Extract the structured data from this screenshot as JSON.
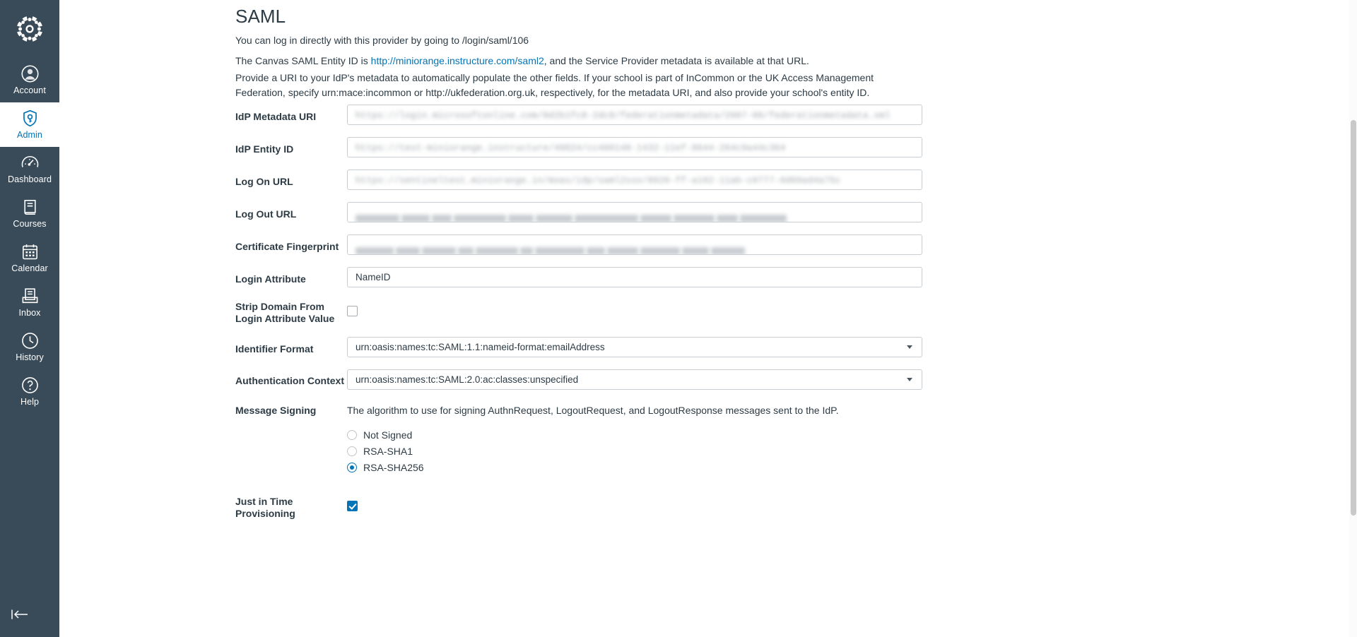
{
  "sidebar": {
    "logo_name": "canvas-logo",
    "items": [
      {
        "label": "Account",
        "icon": "user-circle-icon",
        "active": false
      },
      {
        "label": "Admin",
        "icon": "shield-key-icon",
        "active": true
      },
      {
        "label": "Dashboard",
        "icon": "speedometer-icon",
        "active": false
      },
      {
        "label": "Courses",
        "icon": "book-icon",
        "active": false
      },
      {
        "label": "Calendar",
        "icon": "calendar-icon",
        "active": false
      },
      {
        "label": "Inbox",
        "icon": "inbox-tray-icon",
        "active": false
      },
      {
        "label": "History",
        "icon": "clock-icon",
        "active": false
      },
      {
        "label": "Help",
        "icon": "question-circle-icon",
        "active": false
      }
    ],
    "collapse_icon": "collapse-left-arrow-icon",
    "accent_active_color": "#0374B5",
    "background_color": "#394B58"
  },
  "page": {
    "title": "SAML",
    "intro_line": "You can log in directly with this provider by going to /login/saml/106",
    "entity_line_prefix": "The Canvas SAML Entity ID is ",
    "entity_link": "http://miniorange.instructure.com/saml2",
    "entity_line_suffix": ", and the Service Provider metadata is available at that URL.",
    "metadata_paragraph": "Provide a URI to your IdP's metadata to automatically populate the other fields. If your school is part of InCommon or the UK Access Management Federation, specify urn:mace:incommon or http://ukfederation.org.uk, respectively, for the metadata URI, and also provide your school's entity ID.",
    "link_color": "#0374B5"
  },
  "form": {
    "idp_metadata_uri": {
      "label": "IdP Metadata URI",
      "value": "https://login.microsoftonline.com/8d2b1fc8-2dc8/federationmetadata/2007-06/federationmetadata.xml",
      "redacted": true
    },
    "idp_entity_id": {
      "label": "IdP Entity ID",
      "value": "https://test-miniorange.instructure/49824/cc400148-1432-11ef-8644-264c9a44c364",
      "redacted": true
    },
    "log_on_url": {
      "label": "Log On URL",
      "value": "https://sentineltest.miniorange.in/moas/idp/saml2sso/8920-ff-a102-11ab-c0777-0d60ad4a75c",
      "redacted": true
    },
    "log_out_url": {
      "label": "Log Out URL",
      "value": "",
      "redacted": true
    },
    "certificate_fingerprint": {
      "label": "Certificate Fingerprint",
      "value": "",
      "redacted": true
    },
    "login_attribute": {
      "label": "Login Attribute",
      "value": "NameID",
      "redacted": false
    },
    "strip_domain": {
      "label": "Strip Domain From Login Attribute Value",
      "checked": false
    },
    "identifier_format": {
      "label": "Identifier Format",
      "value": "urn:oasis:names:tc:SAML:1.1:nameid-format:emailAddress"
    },
    "authentication_context": {
      "label": "Authentication Context",
      "value": "urn:oasis:names:tc:SAML:2.0:ac:classes:unspecified"
    },
    "message_signing": {
      "label": "Message Signing",
      "help": "The algorithm to use for signing AuthnRequest, LogoutRequest, and LogoutResponse messages sent to the IdP.",
      "options": [
        {
          "label": "Not Signed",
          "selected": false
        },
        {
          "label": "RSA-SHA1",
          "selected": false
        },
        {
          "label": "RSA-SHA256",
          "selected": true
        }
      ]
    },
    "just_in_time": {
      "label": "Just in Time",
      "label_line2": "Provisioning",
      "checked": true
    }
  }
}
